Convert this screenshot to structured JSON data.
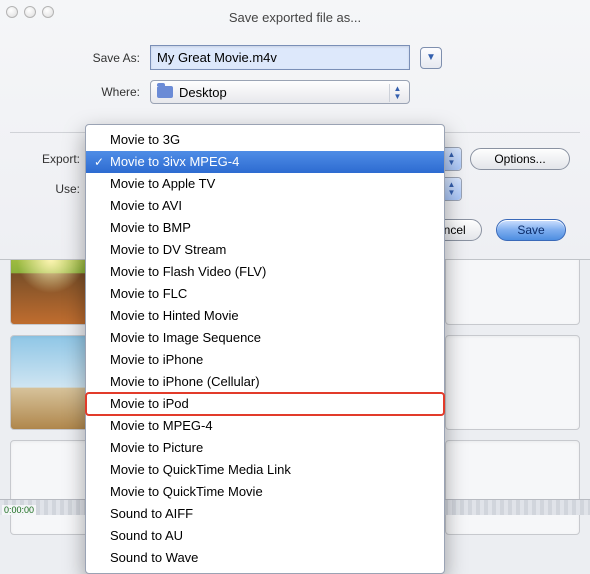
{
  "window_title": "Save exported file as...",
  "form": {
    "save_as_label": "Save As:",
    "save_as_value": "My Great Movie.m4v",
    "where_label": "Where:",
    "where_value": "Desktop"
  },
  "bottom": {
    "export_label": "Export:",
    "export_selected": "Movie to 3ivx MPEG-4",
    "use_label": "Use:",
    "options_label": "Options...",
    "cancel_label": "Cancel",
    "save_label": "Save"
  },
  "dropdown": {
    "selected_index": 1,
    "highlighted_index": 12,
    "items": [
      "Movie to 3G",
      "Movie to 3ivx MPEG-4",
      "Movie to Apple TV",
      "Movie to AVI",
      "Movie to BMP",
      "Movie to DV Stream",
      "Movie to Flash Video (FLV)",
      "Movie to FLC",
      "Movie to Hinted Movie",
      "Movie to Image Sequence",
      "Movie to iPhone",
      "Movie to iPhone (Cellular)",
      "Movie to iPod",
      "Movie to MPEG-4",
      "Movie to Picture",
      "Movie to QuickTime Media Link",
      "Movie to QuickTime Movie",
      "Sound to AIFF",
      "Sound to AU",
      "Sound to Wave"
    ]
  },
  "timeline_timestamp": "0:00:00"
}
